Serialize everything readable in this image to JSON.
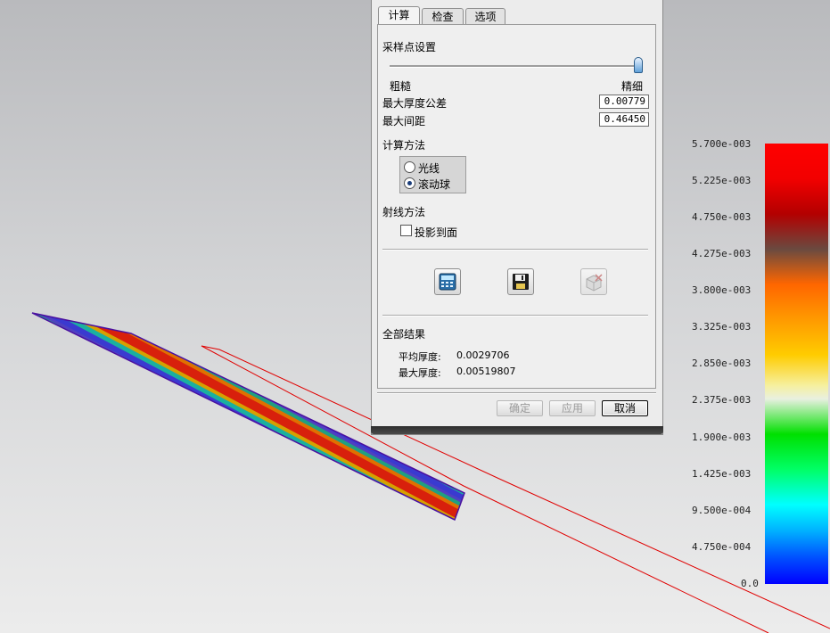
{
  "tabs": [
    "计算",
    "检查",
    "选项"
  ],
  "sampling": {
    "title": "采样点设置",
    "coarse_label": "粗糙",
    "fine_label": "精细",
    "slider_level": 1.0
  },
  "params": {
    "max_thickness_tol_label": "最大厚度公差",
    "max_thickness_tol_value": "0.00779",
    "max_spacing_label": "最大间距",
    "max_spacing_value": "0.46450"
  },
  "method": {
    "title": "计算方法",
    "options": [
      {
        "label": "光线",
        "selected": false
      },
      {
        "label": "滚动球",
        "selected": true
      }
    ]
  },
  "ray": {
    "title": "射线方法",
    "project_label": "投影到面",
    "project_checked": false
  },
  "toolbar_icons": [
    "calculator-icon",
    "save-icon",
    "delete-icon"
  ],
  "results": {
    "title": "全部结果",
    "avg_label": "平均厚度:",
    "avg_value": "0.0029706",
    "max_label": "最大厚度:",
    "max_value": "0.00519807"
  },
  "buttons": {
    "ok": "确定",
    "apply": "应用",
    "cancel": "取消"
  },
  "legend": {
    "labels": [
      "5.700e-003",
      "5.225e-003",
      "4.750e-003",
      "4.275e-003",
      "3.800e-003",
      "3.325e-003",
      "2.850e-003",
      "2.375e-003",
      "1.900e-003",
      "1.425e-003",
      "9.500e-004",
      "4.750e-004",
      "0.0"
    ],
    "max_color": "#ff0000",
    "min_color": "#0000ff"
  }
}
